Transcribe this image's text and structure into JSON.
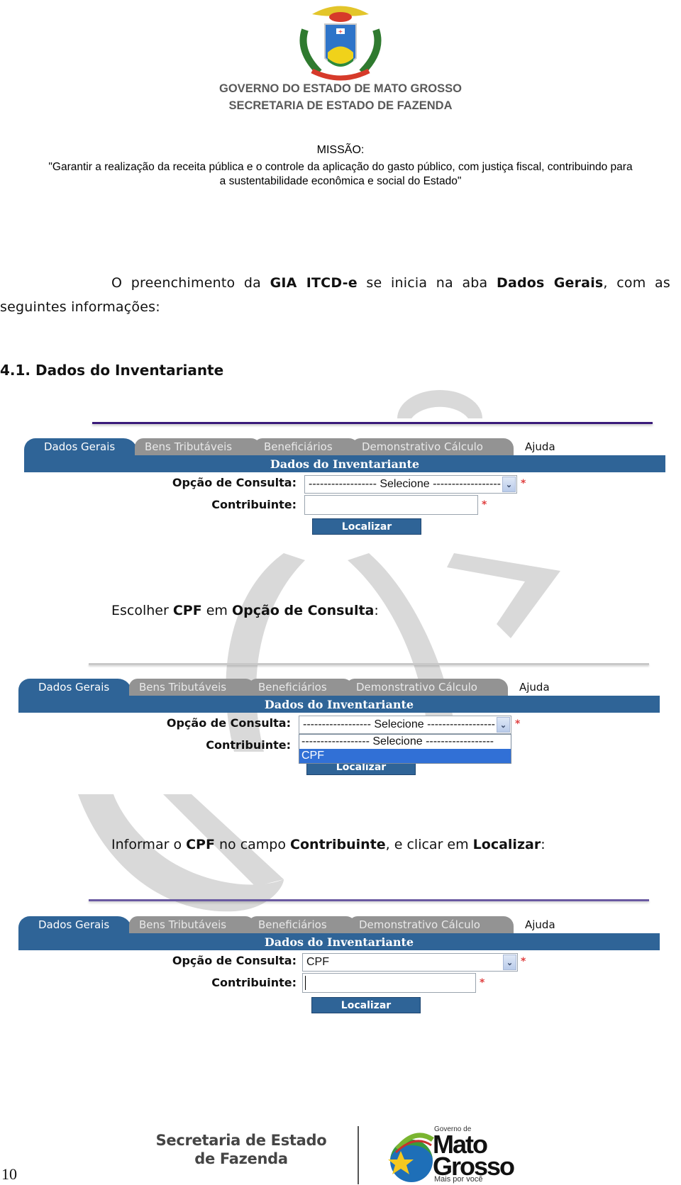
{
  "header": {
    "government": "GOVERNO DO ESTADO DE MATO GROSSO",
    "secretariat": "SECRETARIA DE ESTADO DE FAZENDA",
    "mission_title": "MISSÃO:",
    "mission_line1": "\"Garantir a realização da receita pública e o controle da aplicação do gasto público, com justiça fiscal, contribuindo para",
    "mission_line2": "a sustentabilidade econômica e social do Estado\""
  },
  "intro": {
    "part1": "O preenchimento da ",
    "bold1": "GIA ITCD-e",
    "part2": " se inicia na aba ",
    "bold2": "Dados Gerais",
    "part3": ", com as seguintes informações:"
  },
  "section_heading": "4.1.  Dados do Inventariante",
  "step1": {
    "t1": "Escolher ",
    "b1": "CPF",
    "t2": " em ",
    "b2": "Opção de Consulta",
    "t3": ":"
  },
  "step2": {
    "t1": "Informar o ",
    "b1": "CPF",
    "t2": " no campo ",
    "b2": "Contribuinte",
    "t3": ", e clicar em ",
    "b3": "Localizar",
    "t4": ":"
  },
  "form": {
    "tabs": [
      "Dados Gerais",
      "Bens Tributáveis",
      "Beneficiários",
      "Demonstrativo Cálculo",
      "Ajuda"
    ],
    "section_title": "Dados do Inventariante",
    "consulta_label": "Opção de Consulta:",
    "contribuinte_label": "Contribuinte:",
    "required_mark": "*",
    "button_label": "Localizar",
    "options": [
      "------------------ Selecione ------------------",
      "CPF"
    ],
    "colors": {
      "primary": "#2f6497",
      "inactive_tab": "#939393",
      "highlight": "#3170d6",
      "required": "#e04040"
    }
  },
  "screens": [
    {
      "consulta_value": "------------------ Selecione ------------------",
      "contribuinte_value": "",
      "dropdown_open": false
    },
    {
      "consulta_value": "------------------ Selecione ------------------",
      "contribuinte_value": "",
      "dropdown_open": true,
      "highlighted_option": "CPF"
    },
    {
      "consulta_value": "CPF",
      "contribuinte_value": "",
      "dropdown_open": false,
      "focused": "contribuinte"
    }
  ],
  "footer": {
    "org_line1": "Secretaria de Estado",
    "org_line2": "de Fazenda",
    "logo_top": "Governo de",
    "logo_mato": "Mato",
    "logo_grosso": "Grosso",
    "logo_slogan": "Mais por você",
    "page_number": "10"
  }
}
